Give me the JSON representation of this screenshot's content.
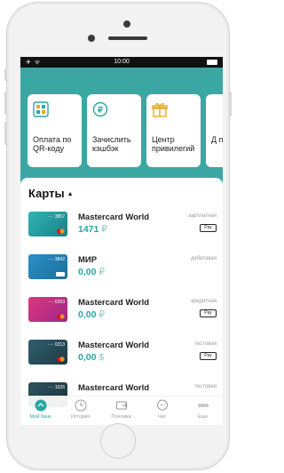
{
  "status_bar": {
    "signal": "✈ ᯤ",
    "time": "10:00"
  },
  "quick_actions": [
    {
      "icon": "qr-icon",
      "label": "Оплата по QR-коду"
    },
    {
      "icon": "cashback-icon",
      "label": "Зачислить кэшбэк"
    },
    {
      "icon": "gift-icon",
      "label": "Центр привилегий"
    },
    {
      "icon": "partial-tile",
      "label": "Д п"
    }
  ],
  "cards_section": {
    "title": "Карты",
    "caret": "▲"
  },
  "cards": [
    {
      "number": "···· 3857",
      "name": "Mastercard World",
      "amount": "1471",
      "currency": "₽",
      "tag": "зарплатная",
      "pay": "Pay",
      "color": "#2fa8a6"
    },
    {
      "number": "···· 3842",
      "name": "МИР",
      "amount": "0,00",
      "currency": "₽",
      "tag": "дебетовая",
      "pay": "",
      "color": "#2b96c7"
    },
    {
      "number": "···· 6253",
      "name": "Mastercard World",
      "amount": "0,00",
      "currency": "₽",
      "tag": "кредитная",
      "pay": "Pay",
      "color": "#d0316b"
    },
    {
      "number": "···· 0213",
      "name": "Mastercard World",
      "amount": "0,00",
      "currency": "$",
      "tag": "тестовая",
      "pay": "Pay",
      "color": "#2b4f5c"
    },
    {
      "number": "···· 1526",
      "name": "Mastercard World",
      "amount": "",
      "currency": "",
      "tag": "тестовая",
      "pay": "",
      "color": "#274650"
    }
  ],
  "tabbar": [
    {
      "icon": "home-icon",
      "label": "Мой банк",
      "active": true
    },
    {
      "icon": "history-icon",
      "label": "История",
      "active": false
    },
    {
      "icon": "payments-icon",
      "label": "Платежи",
      "active": false
    },
    {
      "icon": "chat-icon",
      "label": "Чат",
      "active": false
    },
    {
      "icon": "more-icon",
      "label": "Еще",
      "active": false
    }
  ],
  "colors": {
    "accent": "#2aa6a0",
    "header_bg": "#3ba7a2"
  }
}
